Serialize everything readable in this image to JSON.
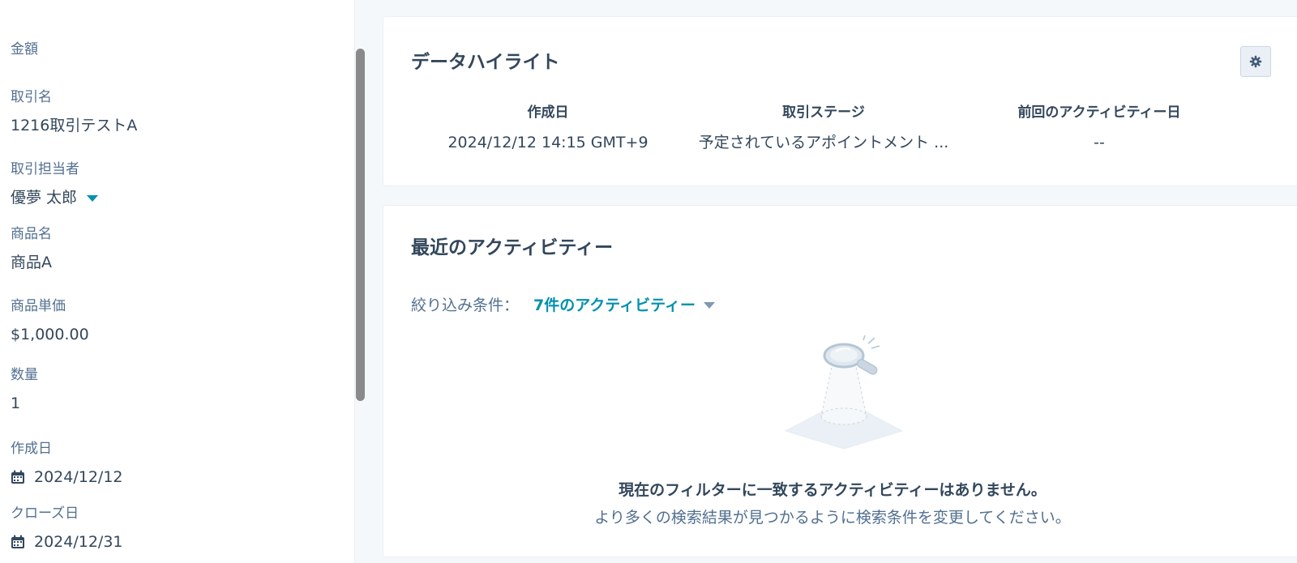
{
  "sidebar": {
    "properties": [
      {
        "label": "金額",
        "value": ""
      },
      {
        "label": "取引名",
        "value": "1216取引テストA"
      },
      {
        "label": "取引担当者",
        "value": "優夢 太郎"
      },
      {
        "label": "商品名",
        "value": "商品A"
      },
      {
        "label": "商品単価",
        "value": "$1,000.00"
      },
      {
        "label": "数量",
        "value": "1"
      },
      {
        "label": "作成日",
        "value": "2024/12/12"
      },
      {
        "label": "クローズ日",
        "value": "2024/12/31"
      }
    ]
  },
  "highlights": {
    "title": "データハイライト",
    "settings_icon": "gear-icon",
    "columns": [
      {
        "label": "作成日",
        "value": "2024/12/12 14:15 GMT+9"
      },
      {
        "label": "取引ステージ",
        "value": "予定されているアポイントメント ..."
      },
      {
        "label": "前回のアクティビティー日",
        "value": "--"
      }
    ]
  },
  "activity": {
    "title": "最近のアクティビティー",
    "filter_label": "絞り込み条件：",
    "filter_value": "7件のアクティビティー",
    "empty_title": "現在のフィルターに一致するアクティビティーはありません。",
    "empty_subtitle": "より多くの検索結果が見つかるように検索条件を変更してください。"
  },
  "colors": {
    "accent": "#0091ae",
    "text": "#33475b",
    "muted": "#516f90",
    "background": "#f5f8fa"
  }
}
